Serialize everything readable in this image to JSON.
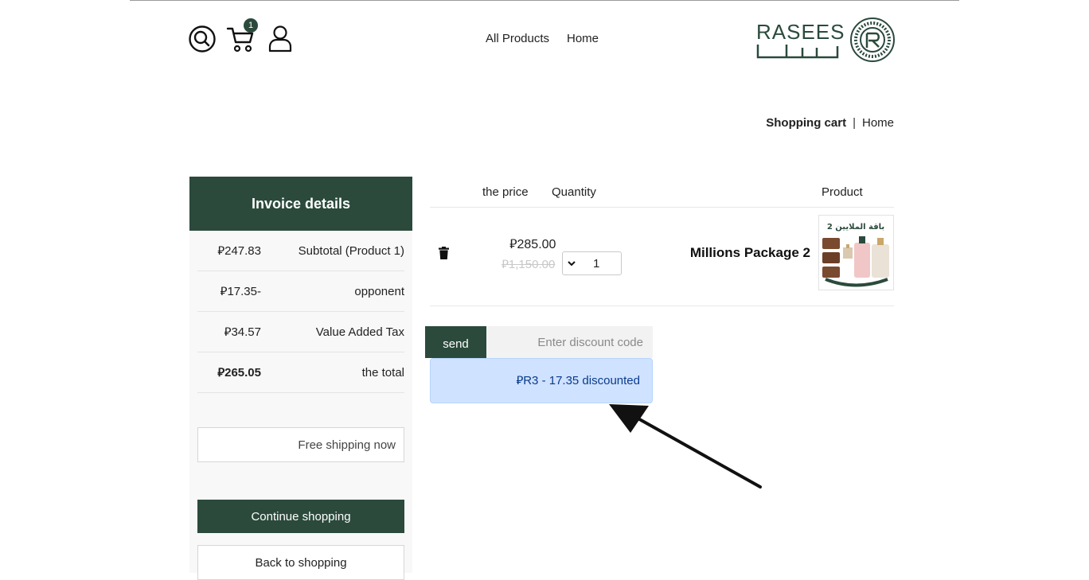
{
  "header": {
    "cart_count": "1",
    "nav": [
      "All Products",
      "Home"
    ],
    "logo_text": "RASEES"
  },
  "breadcrumb": {
    "current": "Shopping cart",
    "separator": "|",
    "home": "Home"
  },
  "invoice": {
    "title": "Invoice details",
    "rows": [
      {
        "label": "Subtotal (Product 1)",
        "value": "⃁247.83"
      },
      {
        "label": "opponent",
        "value": "⃁17.35-"
      },
      {
        "label": "Value Added Tax",
        "value": "⃁34.57"
      },
      {
        "label": "the total",
        "value": "⃁265.05"
      }
    ],
    "free_shipping": "Free shipping now",
    "continue_label": "Continue shopping",
    "back_label": "Back to shopping"
  },
  "table": {
    "headers": {
      "price": "the price",
      "quantity": "Quantity",
      "product": "Product"
    },
    "item": {
      "price_new": "⃁285.00",
      "price_old": "⃁1,150.00",
      "quantity": "1",
      "name": "Millions Package 2",
      "image_caption": "باقة الملايين 2"
    }
  },
  "discount": {
    "send_label": "send",
    "placeholder": "Enter discount code",
    "message": "⃁R3 - 17.35 discounted"
  },
  "colors": {
    "brand": "#2b4a3c",
    "alert_bg": "#cfe2ff",
    "alert_text": "#0a3b8c"
  }
}
